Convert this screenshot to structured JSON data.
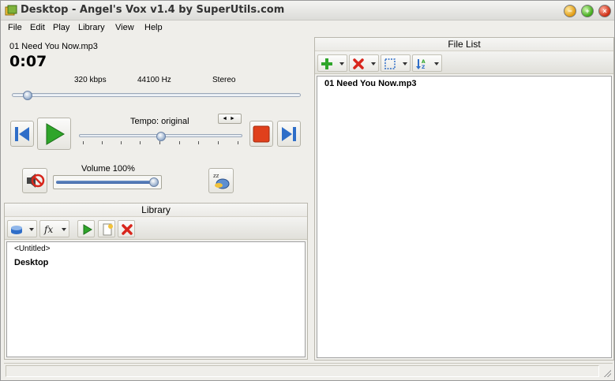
{
  "window": {
    "title": "Desktop - Angel's Vox v1.4 by SuperUtils.com",
    "controls": {
      "minimize": "−",
      "maximize": "+",
      "close": "×"
    }
  },
  "menu": {
    "file": "File",
    "edit": "Edit",
    "play": "Play",
    "library": "Library",
    "view": "View",
    "help": "Help"
  },
  "player": {
    "track_name": "01 Need You Now.mp3",
    "elapsed": "0:07",
    "bitrate": "320 kbps",
    "sample_rate": "44100 Hz",
    "channels": "Stereo",
    "seek_position": 0.04,
    "tempo_label": "Tempo: original",
    "tempo_arrows": "◄►",
    "tempo_position": 0.5,
    "volume_label": "Volume 100%",
    "volume_value": 1.0
  },
  "library": {
    "header": "Library",
    "items": [
      "<Untitled>",
      "Desktop"
    ]
  },
  "file_list": {
    "header": "File List",
    "files": [
      "01 Need You Now.mp3"
    ]
  },
  "colors": {
    "accent_blue": "#2f6ec8",
    "play_green": "#2fa52a",
    "stop_red": "#e0401c"
  },
  "icons": {
    "prev": "skip-back-icon",
    "play": "play-icon",
    "stop": "stop-icon",
    "next": "skip-forward-icon",
    "mute": "mute-speaker-icon",
    "sleep": "sleep-timer-icon"
  }
}
